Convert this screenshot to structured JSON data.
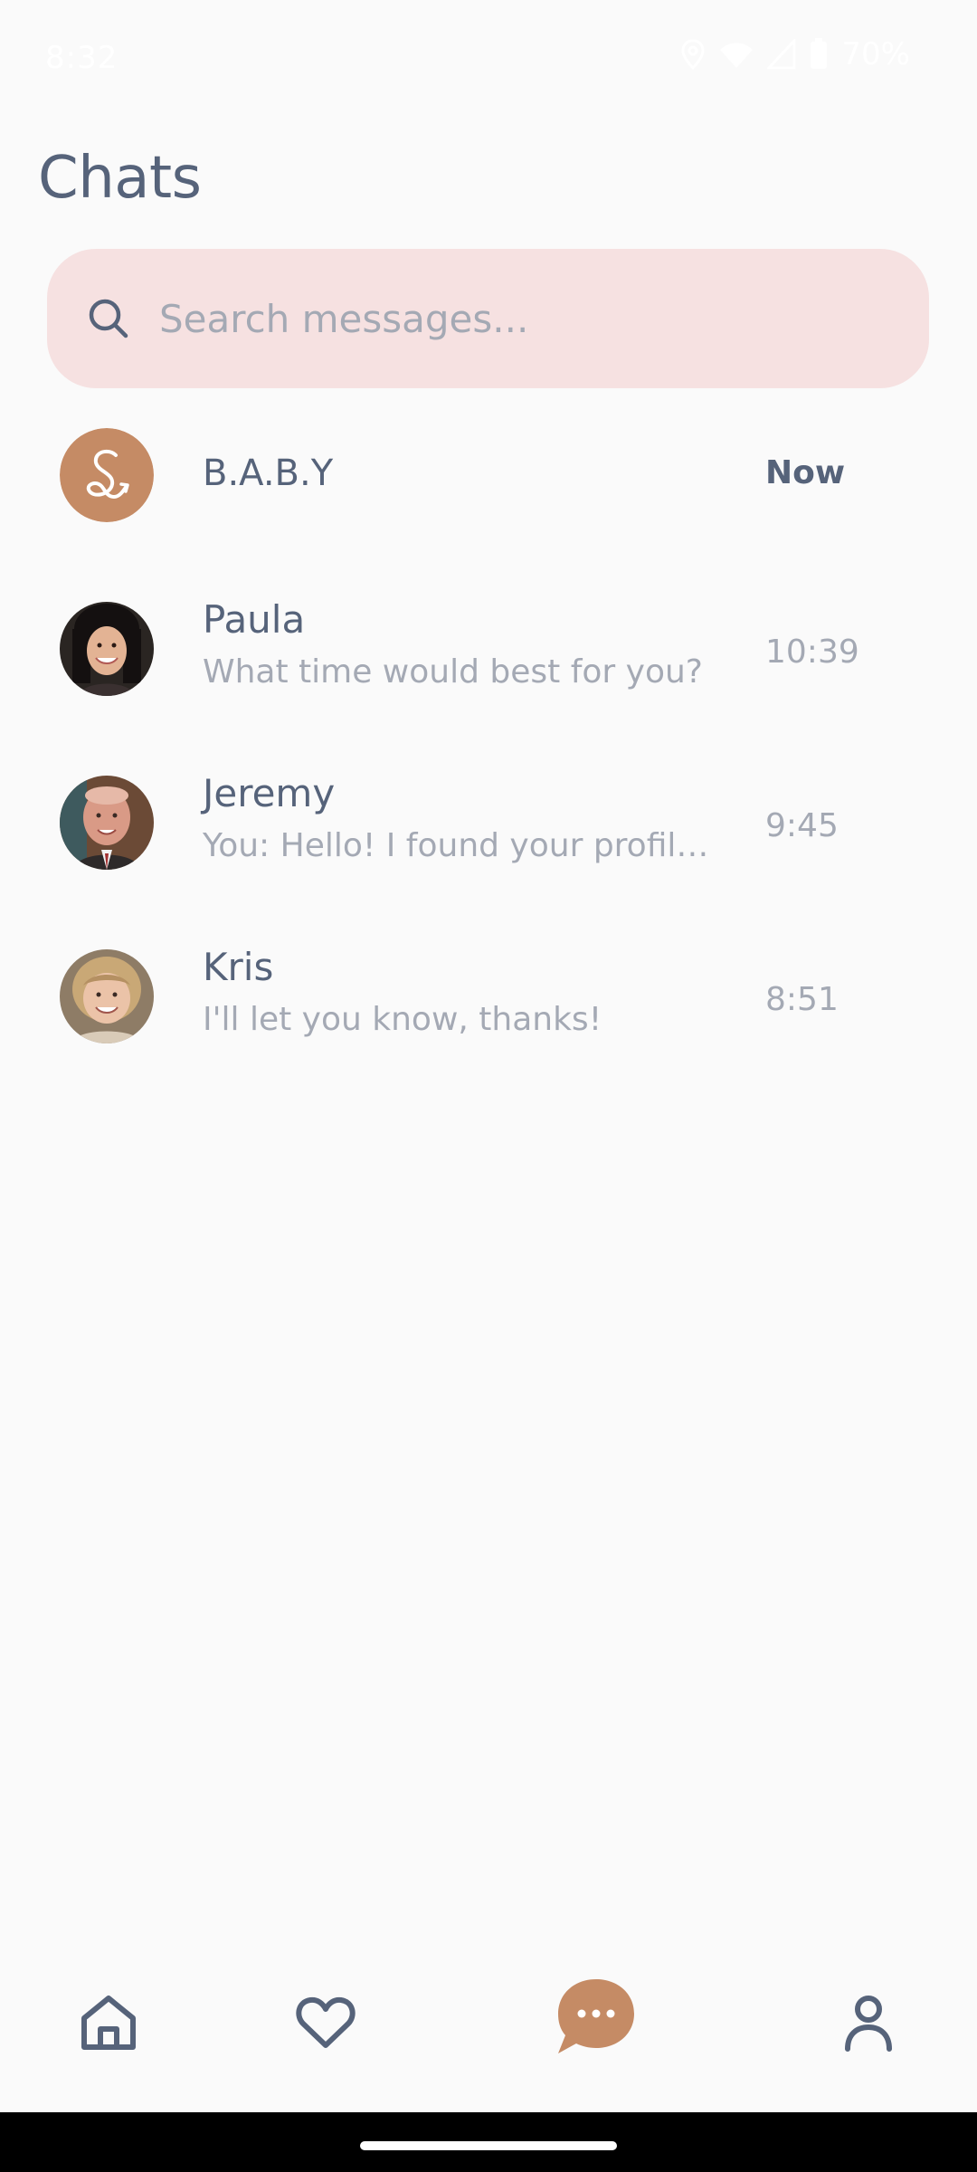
{
  "status_bar": {
    "time": "8:32",
    "battery": "70%"
  },
  "page": {
    "title": "Chats"
  },
  "search": {
    "placeholder": "Search messages..."
  },
  "chats": [
    {
      "name": "B.A.B.Y",
      "preview": "",
      "time": "Now",
      "avatar": "baby-logo"
    },
    {
      "name": "Paula",
      "preview": "What time would best for you?",
      "time": "10:39",
      "avatar": "photo-paula"
    },
    {
      "name": "Jeremy",
      "preview": "You: Hello! I found your profile...",
      "time": "9:45",
      "avatar": "photo-jeremy"
    },
    {
      "name": "Kris",
      "preview": "I'll let you know, thanks!",
      "time": "8:51",
      "avatar": "photo-kris"
    }
  ],
  "bottom_nav": {
    "items": [
      "home-icon",
      "heart-icon",
      "chat-icon",
      "profile-icon"
    ],
    "active": "chat-icon"
  },
  "colors": {
    "background": "#FAFAFA",
    "primary_text": "#56637A",
    "secondary_text": "#A4A9B4",
    "search_bg": "#F6E1E1",
    "accent": "#C58B65"
  }
}
